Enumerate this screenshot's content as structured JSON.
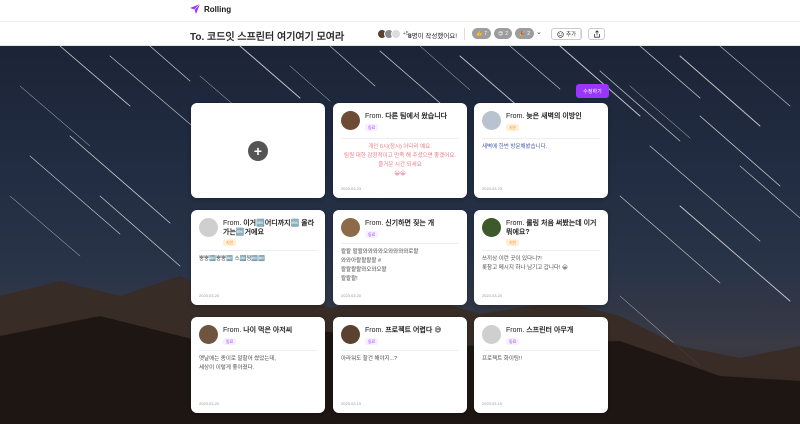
{
  "nav": {
    "logo_text": "Rolling"
  },
  "header": {
    "title": "To. 코드잇 스프린터 여기여기 모여라",
    "avatar_more": "+5",
    "writer_count_num": "8",
    "writer_count_text": "명이 작성했어요!",
    "reactions": [
      {
        "emoji": "👍",
        "count": "7"
      },
      {
        "emoji": "😍",
        "count": "2"
      },
      {
        "emoji": "🎉",
        "count": "2"
      }
    ],
    "add_label": "추가",
    "chevron": "⌄"
  },
  "board": {
    "edit_label": "수정하기",
    "add_card_symbol": "+",
    "cards": [
      {
        "from_prefix": "From.",
        "name": "다른 팀에서 왔습니다",
        "relation": "동료",
        "relation_type": "friend",
        "body": "개인 6시(정시) 아다리 예요.\n팀원 대한 감정적이고 만족 해 주셨으면 좋겠어요. 즐거운 시간 되세요\n😀😀",
        "date": "2023.03.23",
        "avatar_color": "#6d4b35",
        "body_color": "#e77a87",
        "body_align": "center"
      },
      {
        "from_prefix": "From.",
        "name": "늦은 새벽의 이방인",
        "relation": "지인",
        "relation_type": "colleague",
        "body": "새벽에 한번 방문해봤습니다.",
        "date": "2023.03.23",
        "avatar_color": "#b9c3cf",
        "body_color": "#4b5aa5",
        "body_align": "left"
      },
      {
        "from_prefix": "From.",
        "name": "이거🔤어디까지🔤 올라가는🔤거에요",
        "relation": "지인",
        "relation_type": "colleague",
        "body": "뿡뿡🔤뿡뿡🔤 스🔤짱🔤🔤",
        "date": "2023.03.20",
        "avatar_color": "#cfcfcf",
        "body_color": "#444",
        "body_align": "left"
      },
      {
        "from_prefix": "From.",
        "name": "신기하면 짖는 개",
        "relation": "동료",
        "relation_type": "friend",
        "body": "왈왈 왈왈와와와와오와와와와로왈\n와와아왈왈왈왈 #\n왈왈왈왈와오와오왈\n왈왈왈!",
        "date": "2023.03.20",
        "avatar_color": "#8d6a48",
        "body_color": "#333",
        "body_align": "left"
      },
      {
        "from_prefix": "From.",
        "name": "롤링 처음 써봤는데 이거 뭐에요?",
        "relation": "지인",
        "relation_type": "colleague",
        "body": "쓰끼상 이런 곳이 있다니?!\n롯참고 메시지 하나 남기고 갑니다! 😀",
        "date": "2023.03.20",
        "avatar_color": "#3c5a2a",
        "body_color": "#333",
        "body_align": "left"
      },
      {
        "from_prefix": "From.",
        "name": "나이 먹은 아저씨",
        "relation": "동료",
        "relation_type": "friend",
        "body": "옛날에는 종이로 말할어 썼었는데,\n세상이 이렇게 좋아졌다.",
        "date": "2023.03.20",
        "avatar_color": "#6f5440",
        "body_color": "#333",
        "body_align": "left"
      },
      {
        "from_prefix": "From.",
        "name": "프로젝트 어렵다 😅",
        "relation": "동료",
        "relation_type": "friend",
        "body": "아라워도 할건 해야지...?",
        "date": "2023.03.19",
        "avatar_color": "#5a4130",
        "body_color": "#333",
        "body_align": "left"
      },
      {
        "from_prefix": "From.",
        "name": "스프린터 아무개",
        "relation": "동료",
        "relation_type": "friend",
        "body": "프로젝트 화이팅!!",
        "date": "2023.03.19",
        "avatar_color": "#cfcfcf",
        "body_color": "#333",
        "body_align": "left"
      }
    ]
  }
}
